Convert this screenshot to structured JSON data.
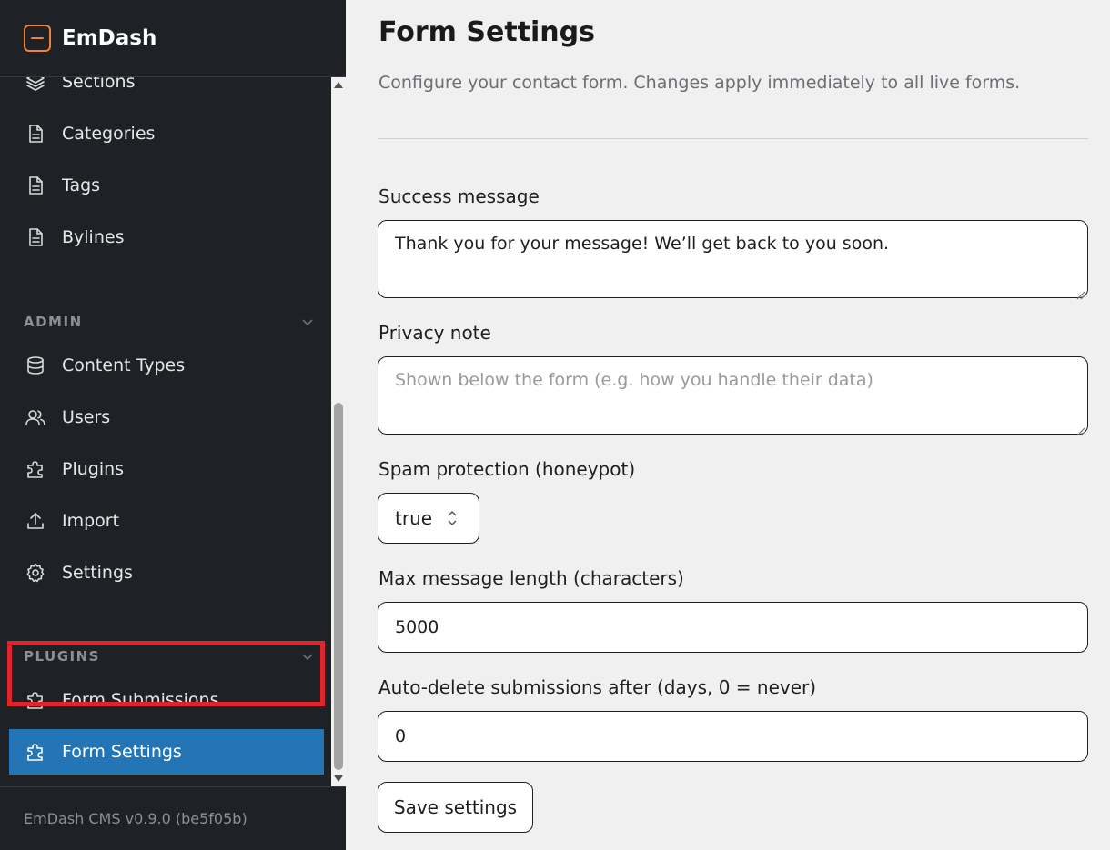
{
  "app": {
    "name": "EmDash",
    "version": "EmDash CMS v0.9.0 (be5f05b)"
  },
  "sidebar": {
    "content_items": [
      {
        "label": "Sections",
        "icon": "layers-icon"
      },
      {
        "label": "Categories",
        "icon": "document-icon"
      },
      {
        "label": "Tags",
        "icon": "document-icon"
      },
      {
        "label": "Bylines",
        "icon": "document-icon"
      }
    ],
    "admin": {
      "heading": "ADMIN",
      "items": [
        {
          "label": "Content Types",
          "icon": "database-icon"
        },
        {
          "label": "Users",
          "icon": "users-icon"
        },
        {
          "label": "Plugins",
          "icon": "puzzle-icon"
        },
        {
          "label": "Import",
          "icon": "upload-icon"
        },
        {
          "label": "Settings",
          "icon": "gear-icon"
        }
      ]
    },
    "plugins": {
      "heading": "PLUGINS",
      "items": [
        {
          "label": "Form Submissions",
          "icon": "puzzle-icon"
        },
        {
          "label": "Form Settings",
          "icon": "puzzle-icon",
          "active": true
        }
      ]
    }
  },
  "main": {
    "title": "Form Settings",
    "subtitle": "Configure your contact form. Changes apply immediately to all live forms.",
    "fields": {
      "success_message": {
        "label": "Success message",
        "value": "Thank you for your message! We’ll get back to you soon."
      },
      "privacy_note": {
        "label": "Privacy note",
        "value": "",
        "placeholder": "Shown below the form (e.g. how you handle their data)"
      },
      "spam_protection": {
        "label": "Spam protection (honeypot)",
        "value": "true"
      },
      "max_length": {
        "label": "Max message length (characters)",
        "value": "5000"
      },
      "auto_delete": {
        "label": "Auto-delete submissions after (days, 0 = never)",
        "value": "0"
      }
    },
    "save_label": "Save settings"
  },
  "colors": {
    "sidebar_bg": "#1e2227",
    "active_bg": "#2475b5",
    "highlight": "#e0242b",
    "brand_accent": "#f0833a",
    "main_bg": "#f0f0f0"
  }
}
